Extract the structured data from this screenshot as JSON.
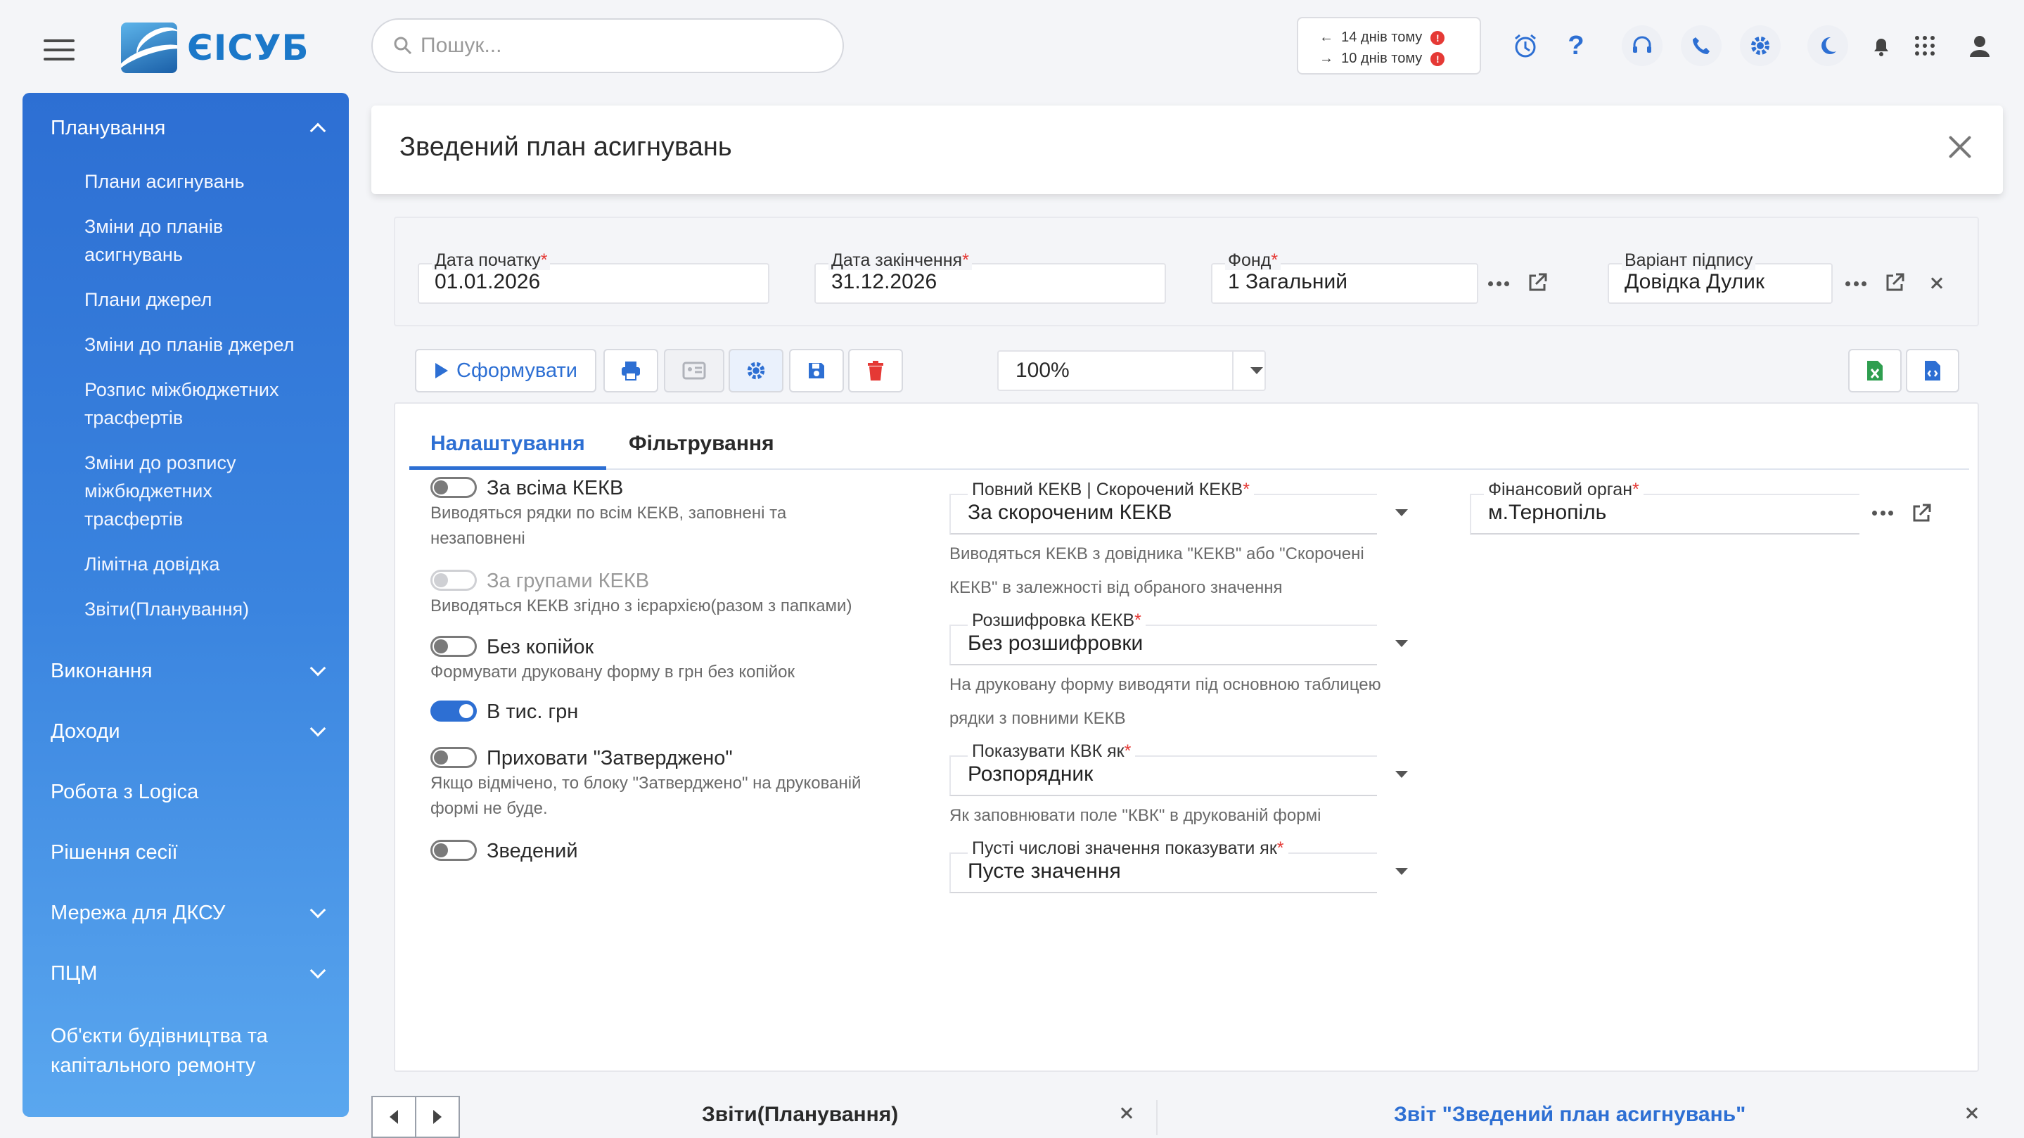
{
  "app": {
    "logo_text": "ЄІСУБ"
  },
  "search": {
    "placeholder": "Пошук..."
  },
  "history": {
    "back": "14 днів тому",
    "forward": "10 днів тому",
    "badge": "!"
  },
  "sidebar": {
    "sections": [
      {
        "label": "Планування",
        "expanded": true,
        "items": [
          {
            "label": "Плани асигнувань"
          },
          {
            "label": "Зміни до планів асигнувань"
          },
          {
            "label": "Плани джерел"
          },
          {
            "label": "Зміни до планів джерел"
          },
          {
            "label": "Розпис міжбюджетних трасфертів"
          },
          {
            "label": "Зміни до розпису міжбюджетних трасфертів"
          },
          {
            "label": "Лімітна довідка"
          },
          {
            "label": "Звіти(Планування)"
          }
        ]
      },
      {
        "label": "Виконання"
      },
      {
        "label": "Доходи"
      },
      {
        "label": "Робота з Logica"
      },
      {
        "label": "Рішення сесії"
      },
      {
        "label": "Мережа для ДКСУ"
      },
      {
        "label": "ПЦМ"
      },
      {
        "label": "Об'єкти будівництва та капітального ремонту"
      }
    ]
  },
  "page": {
    "title": "Зведений план асигнувань"
  },
  "params": {
    "start_date": {
      "label": "Дата початку",
      "value": "01.01.2026"
    },
    "end_date": {
      "label": "Дата закінчення",
      "value": "31.12.2026"
    },
    "fund": {
      "label": "Фонд",
      "value": "1 Загальний"
    },
    "signature": {
      "label": "Варіант підпису",
      "value": "Довідка Дулик"
    },
    "required_mark": "*"
  },
  "toolbar": {
    "generate_label": "Сформувати",
    "zoom": "100%"
  },
  "tabs": [
    {
      "label": "Налаштування",
      "active": true
    },
    {
      "label": "Фільтрування"
    }
  ],
  "options": [
    {
      "title": "За всіма КЕКВ",
      "desc_lines": [
        "Виводяться рядки по всім КЕКВ, заповнені та",
        "незаповнені"
      ],
      "on": false
    },
    {
      "title": "За групами КЕКВ",
      "desc_lines": [
        "Виводяться КЕКВ згідно з ієрархією(разом з папками)"
      ],
      "on": false,
      "disabled": true
    },
    {
      "title": "Без копійок",
      "desc_lines": [
        "Формувати друковану форму в грн без копійок"
      ],
      "on": false
    },
    {
      "title": "В тис. грн",
      "desc_lines": [],
      "on": true
    },
    {
      "title": "Приховати \"Затверджено\"",
      "desc_lines": [
        "Якщо відмічено, то блоку \"Затверджено\" на друкованій",
        "формі не буде."
      ],
      "on": false
    },
    {
      "title": "Зведений",
      "desc_lines": [],
      "on": false
    }
  ],
  "selects": [
    {
      "label": "Повний КЕКВ | Скорочений КЕКВ",
      "value": "За скороченим КЕКВ",
      "hint_lines": [
        "Виводяться КЕКВ з довідника \"КЕКВ\" або \"Скорочені",
        "КЕКВ\" в залежності від обраного значення"
      ]
    },
    {
      "label": "Розшифровка КЕКВ",
      "value": "Без розшифровки",
      "hint_lines": [
        "На друковану форму виводяти під основною таблицею",
        "рядки з повними КЕКВ"
      ]
    },
    {
      "label": "Показувати КВК як",
      "value": "Розпорядник",
      "hint_lines": [
        "Як заповнювати поле \"КВК\" в друкованій формі"
      ]
    },
    {
      "label": "Пусті числові значення показувати як",
      "value": "Пусте значення",
      "hint_lines": []
    }
  ],
  "fin_org": {
    "label": "Фінансовий орган",
    "value": "м.Тернопіль"
  },
  "bottom_tabs": [
    {
      "label": "Звіти(Планування)"
    },
    {
      "label": "Звіт \"Зведений план асигнувань\"",
      "active": true
    }
  ],
  "colors": {
    "accent": "#2d6fd3",
    "required": "#e53935",
    "excel": "#2e9e4f",
    "delete": "#e53935"
  }
}
